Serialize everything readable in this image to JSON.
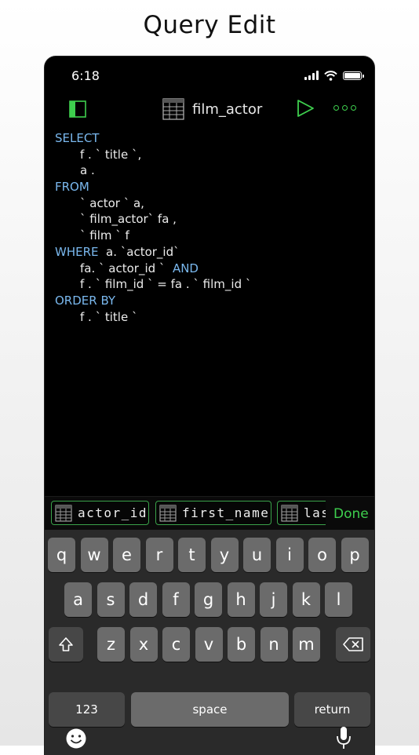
{
  "heading": "Query Edit",
  "status": {
    "time": "6:18"
  },
  "nav": {
    "title": "film_actor"
  },
  "editor": {
    "lines": [
      {
        "indent": false,
        "segments": [
          {
            "kw": true,
            "text": "SELECT"
          }
        ]
      },
      {
        "indent": true,
        "segments": [
          {
            "kw": false,
            "text": "f . ` title `,"
          }
        ]
      },
      {
        "indent": true,
        "segments": [
          {
            "kw": false,
            "text": "a ."
          }
        ]
      },
      {
        "indent": false,
        "segments": [
          {
            "kw": true,
            "text": "FROM"
          }
        ]
      },
      {
        "indent": true,
        "segments": [
          {
            "kw": false,
            "text": "` actor ` a,"
          }
        ]
      },
      {
        "indent": true,
        "segments": [
          {
            "kw": false,
            "text": "` film_actor` fa ,"
          }
        ]
      },
      {
        "indent": true,
        "segments": [
          {
            "kw": false,
            "text": "` film ` f"
          }
        ]
      },
      {
        "indent": false,
        "segments": [
          {
            "kw": true,
            "text": "WHERE"
          },
          {
            "kw": false,
            "text": "  a. `actor_id`"
          }
        ]
      },
      {
        "indent": true,
        "segments": [
          {
            "kw": false,
            "text": "fa. ` actor_id `  "
          },
          {
            "kw": true,
            "text": "AND"
          }
        ]
      },
      {
        "indent": true,
        "segments": [
          {
            "kw": false,
            "text": "f . ` film_id ` = fa . ` film_id `"
          }
        ]
      },
      {
        "indent": false,
        "segments": [
          {
            "kw": true,
            "text": "ORDER BY"
          }
        ]
      },
      {
        "indent": true,
        "segments": [
          {
            "kw": false,
            "text": "f . ` title `"
          }
        ]
      }
    ]
  },
  "suggestions": {
    "chips": [
      "actor_id",
      "first_name",
      "las"
    ],
    "done_label": "Done"
  },
  "keyboard": {
    "row1": [
      "q",
      "w",
      "e",
      "r",
      "t",
      "y",
      "u",
      "i",
      "o",
      "p"
    ],
    "row2": [
      "a",
      "s",
      "d",
      "f",
      "g",
      "h",
      "j",
      "k",
      "l"
    ],
    "row3": [
      "z",
      "x",
      "c",
      "v",
      "b",
      "n",
      "m"
    ],
    "numbers_label": "123",
    "space_label": "space",
    "return_label": "return"
  },
  "colors": {
    "accent": "#3ecf4e",
    "keyword": "#7ab8ee"
  }
}
